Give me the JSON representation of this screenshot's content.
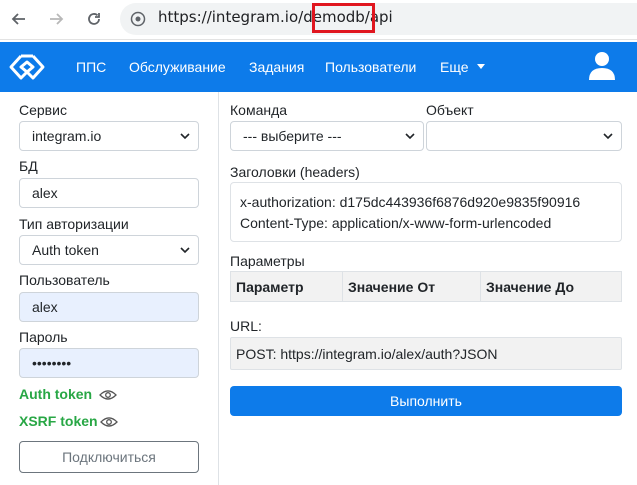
{
  "browser": {
    "url": "https://integram.io/demodb/api"
  },
  "navbar": {
    "items": [
      {
        "label": "ППС"
      },
      {
        "label": "Обслуживание"
      },
      {
        "label": "Задания"
      },
      {
        "label": "Пользователи"
      },
      {
        "label": "Еще"
      }
    ],
    "accent_color": "#0d7bea"
  },
  "left": {
    "service_label": "Сервис",
    "service_value": "integram.io",
    "db_label": "БД",
    "db_value": "alex",
    "auth_type_label": "Тип авторизации",
    "auth_type_value": "Auth token",
    "user_label": "Пользователь",
    "user_value": "alex",
    "password_label": "Пароль",
    "password_value": "••••••••",
    "auth_token_label": "Auth token",
    "xsrf_token_label": "XSRF token",
    "connect_button": "Подключиться"
  },
  "right": {
    "command_label": "Команда",
    "command_value": "--- выберите ---",
    "object_label": "Объект",
    "object_value": "",
    "headers_label": "Заголовки (headers)",
    "headers_line1": "x-authorization: d175dc443936f6876d920e9835f90916",
    "headers_line2": "Content-Type: application/x-www-form-urlencoded",
    "params_label": "Параметры",
    "params_columns": [
      "Параметр",
      "Значение От",
      "Значение До"
    ],
    "url_label": "URL:",
    "url_value": "POST: https://integram.io/alex/auth?JSON",
    "execute_button": "Выполнить"
  }
}
